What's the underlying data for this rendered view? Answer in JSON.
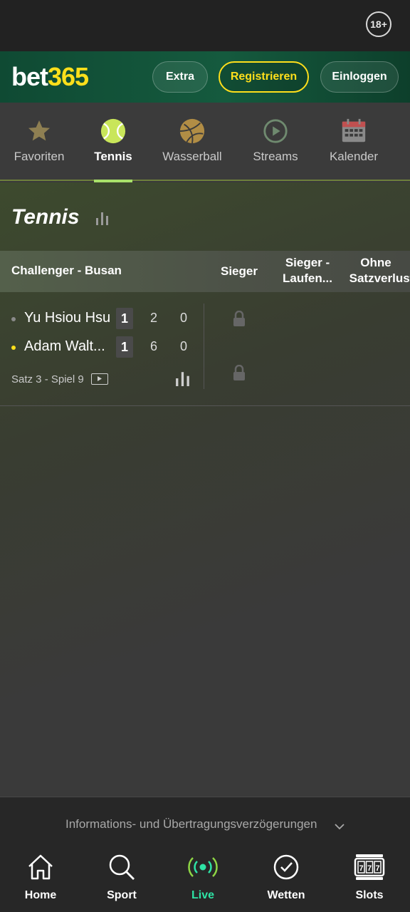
{
  "status_bar": {
    "age_badge": "18+"
  },
  "header": {
    "logo_part1": "bet",
    "logo_part2": "365",
    "extra_label": "Extra",
    "register_label": "Registrieren",
    "login_label": "Einloggen"
  },
  "sport_tabs": [
    {
      "label": "Favoriten",
      "icon": "star-icon",
      "active": false
    },
    {
      "label": "Tennis",
      "icon": "tennis-ball-icon",
      "active": true
    },
    {
      "label": "Wasserball",
      "icon": "water-polo-ball-icon",
      "active": false
    },
    {
      "label": "Streams",
      "icon": "play-circle-icon",
      "active": false
    },
    {
      "label": "Kalender",
      "icon": "calendar-icon",
      "active": false
    }
  ],
  "page": {
    "title": "Tennis"
  },
  "market_header": {
    "competition": "Challenger - Busan",
    "col_sieger": "Sieger",
    "col_laufend_1": "Sieger -",
    "col_laufend_2": "Laufen...",
    "col_ohne_1": "Ohne",
    "col_ohne_2": "Satzverlust"
  },
  "match": {
    "players": [
      {
        "name": "Yu Hsiou Hsu",
        "sets": "1",
        "games": "2",
        "points": "0",
        "serving": false
      },
      {
        "name": "Adam Walt...",
        "sets": "1",
        "games": "6",
        "points": "0",
        "serving": true
      }
    ],
    "status": "Satz 3 - Spiel 9"
  },
  "info_bar": {
    "text": "Informations- und Übertragungsverzögerungen"
  },
  "bottom_nav": [
    {
      "label": "Home",
      "icon": "home-icon",
      "active": false
    },
    {
      "label": "Sport",
      "icon": "search-icon",
      "active": false
    },
    {
      "label": "Live",
      "icon": "live-broadcast-icon",
      "active": true
    },
    {
      "label": "Wetten",
      "icon": "check-circle-icon",
      "active": false
    },
    {
      "label": "Slots",
      "icon": "slots-icon",
      "active": false
    }
  ],
  "colors": {
    "brand_yellow": "#ffdf1b",
    "header_green": "#155a3e",
    "live_accent": "#2ee3a5",
    "tab_underline": "#a8e06a",
    "serving_dot": "#ffdf1b"
  }
}
